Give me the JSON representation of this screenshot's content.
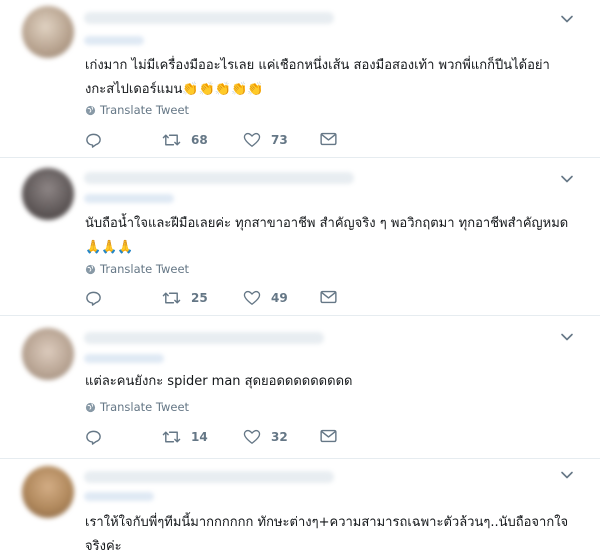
{
  "tweets": [
    {
      "text": "เก่งมาก ไม่มีเครื่องมืออะไรเลย แค่เชือกหนึ่งเส้น สองมือสองเท้า พวกพี่แกก็ปีนได้อย่างกะสไปเดอร์แมน👏👏👏👏👏",
      "translate_label": "Translate Tweet",
      "retweets": "68",
      "likes": "73",
      "avatar_color": "#c9b9a6"
    },
    {
      "text": "นับถือน้ำใจและฝีมือเลยค่ะ ทุกสาขาอาชีพ สำคัญจริง ๆ พอวิกฤตมา ทุกอาชีพสำคัญหมด 🙏🙏🙏",
      "translate_label": "Translate Tweet",
      "retweets": "25",
      "likes": "49",
      "avatar_color": "#6f6a6a"
    },
    {
      "text": "แต่ละคนยังกะ spider man สุดยอดดดดดดดดด",
      "translate_label": "Translate Tweet",
      "retweets": "14",
      "likes": "32",
      "avatar_color": "#b9a595"
    },
    {
      "text": "เราให้ใจกับพี่ๆทีมนี้มากกกกกก ทักษะต่างๆ+ความสามารถเฉพาะตัวล้วนๆ..นับถือจากใจจริงค่ะ",
      "avatar_color": "#b58a5e"
    }
  ],
  "icons": {
    "reply": "reply-icon",
    "retweet": "retweet-icon",
    "like": "heart-icon",
    "message": "envelope-icon",
    "more": "chevron-down-icon",
    "translate": "globe-icon"
  },
  "colors": {
    "text": "#14171a",
    "muted": "#657786",
    "divider": "#e6ecf0"
  }
}
